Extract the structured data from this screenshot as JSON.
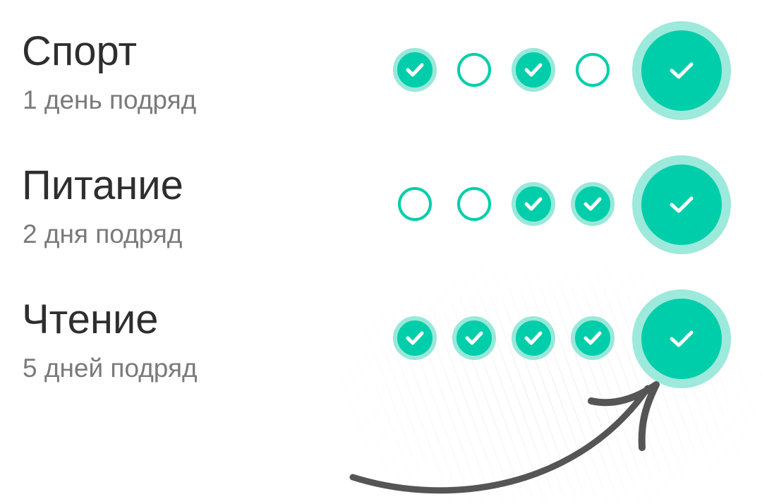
{
  "habits": [
    {
      "title": "Спорт",
      "streak": "1 день подряд",
      "days": [
        true,
        false,
        true,
        false
      ],
      "today_done": true
    },
    {
      "title": "Питание",
      "streak": "2 дня подряд",
      "days": [
        false,
        false,
        true,
        true
      ],
      "today_done": true
    },
    {
      "title": "Чтение",
      "streak": "5 дней подряд",
      "days": [
        true,
        true,
        true,
        true
      ],
      "today_done": true
    }
  ],
  "colors": {
    "accent": "#00ceaa",
    "accent_ring": "#99e8da",
    "title_text": "#2e2e2e",
    "subtitle_text": "#7a7a7a",
    "arrow": "#555555"
  },
  "icons": {
    "day_done": "check-icon",
    "day_empty": "empty-circle",
    "today": "check-icon",
    "annotation": "curved-arrow"
  }
}
